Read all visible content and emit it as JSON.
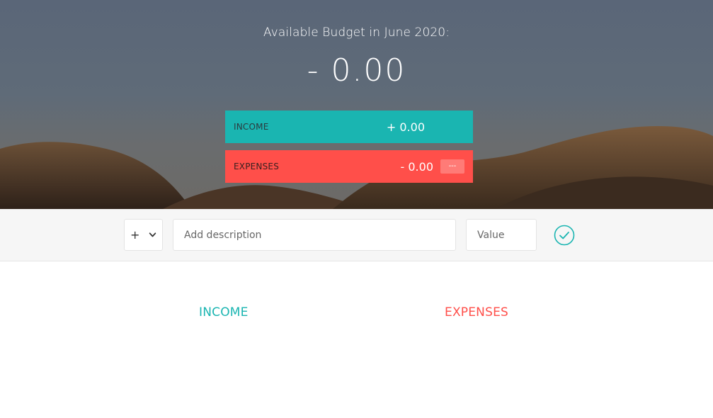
{
  "header": {
    "budget_title": "Available Budget in June 2020:",
    "budget_value": "- 0.00"
  },
  "summary": {
    "income": {
      "label": "INCOME",
      "value": "+ 0.00"
    },
    "expenses": {
      "label": "EXPENSES",
      "value": "- 0.00",
      "percentage": "---"
    }
  },
  "add_form": {
    "type_selected": "+",
    "description_placeholder": "Add description",
    "value_placeholder": "Value",
    "submit_icon": "checkmark-circle-icon"
  },
  "lists": {
    "income_title": "INCOME",
    "expenses_title": "EXPENSES"
  },
  "colors": {
    "income": "#1ab5b1",
    "expenses": "#ff4f4a",
    "header_sky": "#5a6678",
    "hills": "#3a2a1e"
  }
}
